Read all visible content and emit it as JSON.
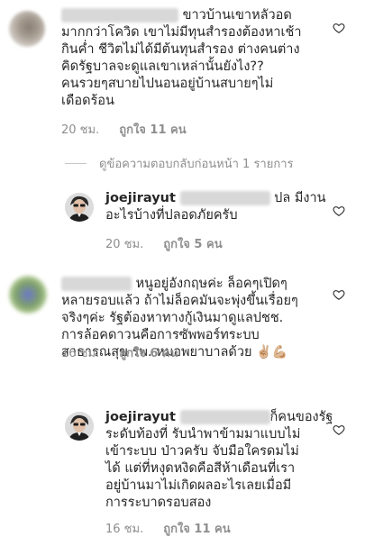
{
  "comments": [
    {
      "lines": [
        "ขาวบ้านเขาหลัวอด",
        "มากกว่าโควิด เขาไม่มีทุนสำรองต้องหาเช้า",
        "กินค่ำ ชีวิตไม่ได้มีต้นทุนสำรอง ต่างคนต่าง",
        "คิดรัฐบาลจะดูแลเขาเหล่านั้นยังไง??",
        "คนรวยๆสบายไปนอนอยู่บ้านสบายๆไม่",
        "เดือดร้อน"
      ],
      "time": "20 ชม.",
      "likes": "ถูกใจ 11 คน"
    },
    {
      "username": "joejirayut",
      "lines": [
        "ปล มีงาน",
        "อะไรบ้างที่ปลอดภัยครับ"
      ],
      "time": "20 ชม.",
      "likes": "ถูกใจ 5 คน"
    },
    {
      "lines": [
        "หนูอยู่อังกฤษค่ะ ล็อคๆเปิดๆ",
        "หลายรอบแล้ว ถ้าไม่ล็อคมันจะพุ่งขึ้นเรื่อยๆ",
        "จริงๆค่ะ รัฐต้องหาทางกู้เงินมาดูแลปชช.",
        "การล้อคดาวนคือการซัพพอร์ทระบบ",
        "สาธารณสุข รพ. หมอพยาบาลด้วย"
      ],
      "emoji": "✌🏼💪🏼",
      "time": "16 ชม.",
      "likes": "ถูกใจ 6 คน"
    },
    {
      "username": "joejirayut",
      "lines": [
        "ก็คนของรัฐ",
        "ระดับท้องที่ รับนำพาข้ามมาแบบไม่",
        "เข้าระบบ ป่าวครับ จับมือใครดมไม่",
        "ได้ แต่ที่หงุดหงิดคือสีห้าเดือนที่เรา",
        "อยู่บ้านมาไม่เกิดผลอะไรเลยเมื่อมี",
        "การระบาดรอบสอง"
      ],
      "time": "16 ชม.",
      "likes": "ถูกใจ 11 คน"
    }
  ],
  "view_replies": "ดูข้อความตอบกลับก่อนหน้า 1 รายการ",
  "icons": {
    "heart": "heart-outline-icon"
  },
  "colors": {
    "text": "#262626",
    "muted": "#8e8e8e"
  }
}
